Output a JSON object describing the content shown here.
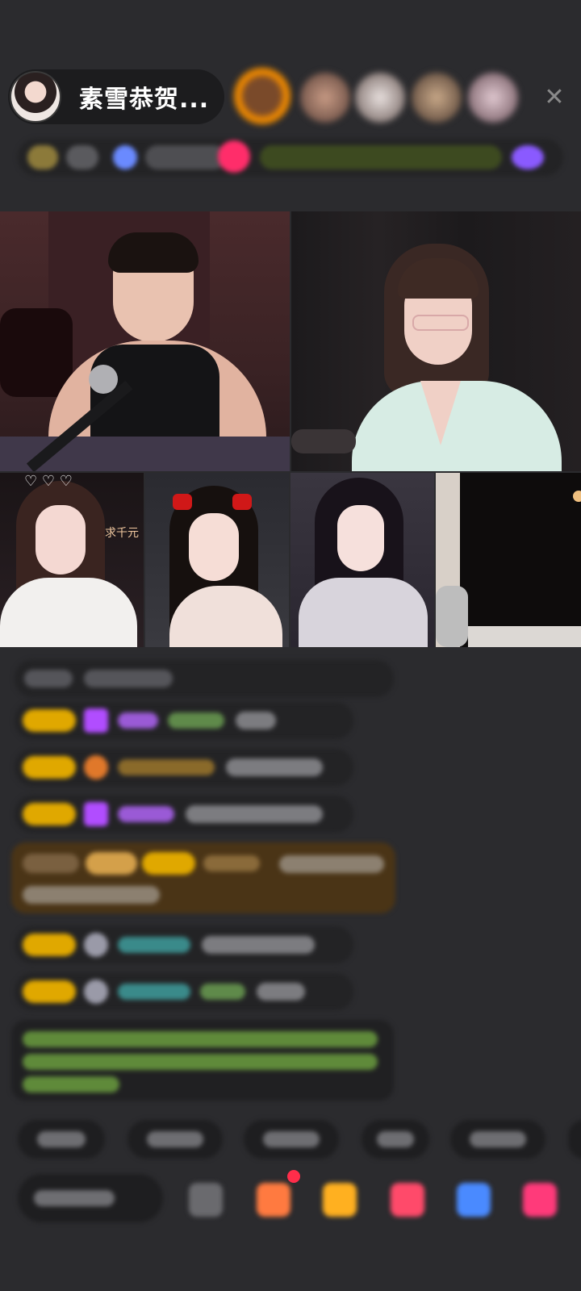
{
  "header": {
    "host_name": "素雪恭贺..."
  },
  "video": {
    "tile3_overlay_text": "求千元"
  },
  "colors": {
    "background": "#2b2b2e",
    "badge_gold": "#e0a800",
    "purple_gem": "#b14dff",
    "special_message_bg": "#4a3416",
    "green_text": "#8fd14f"
  }
}
